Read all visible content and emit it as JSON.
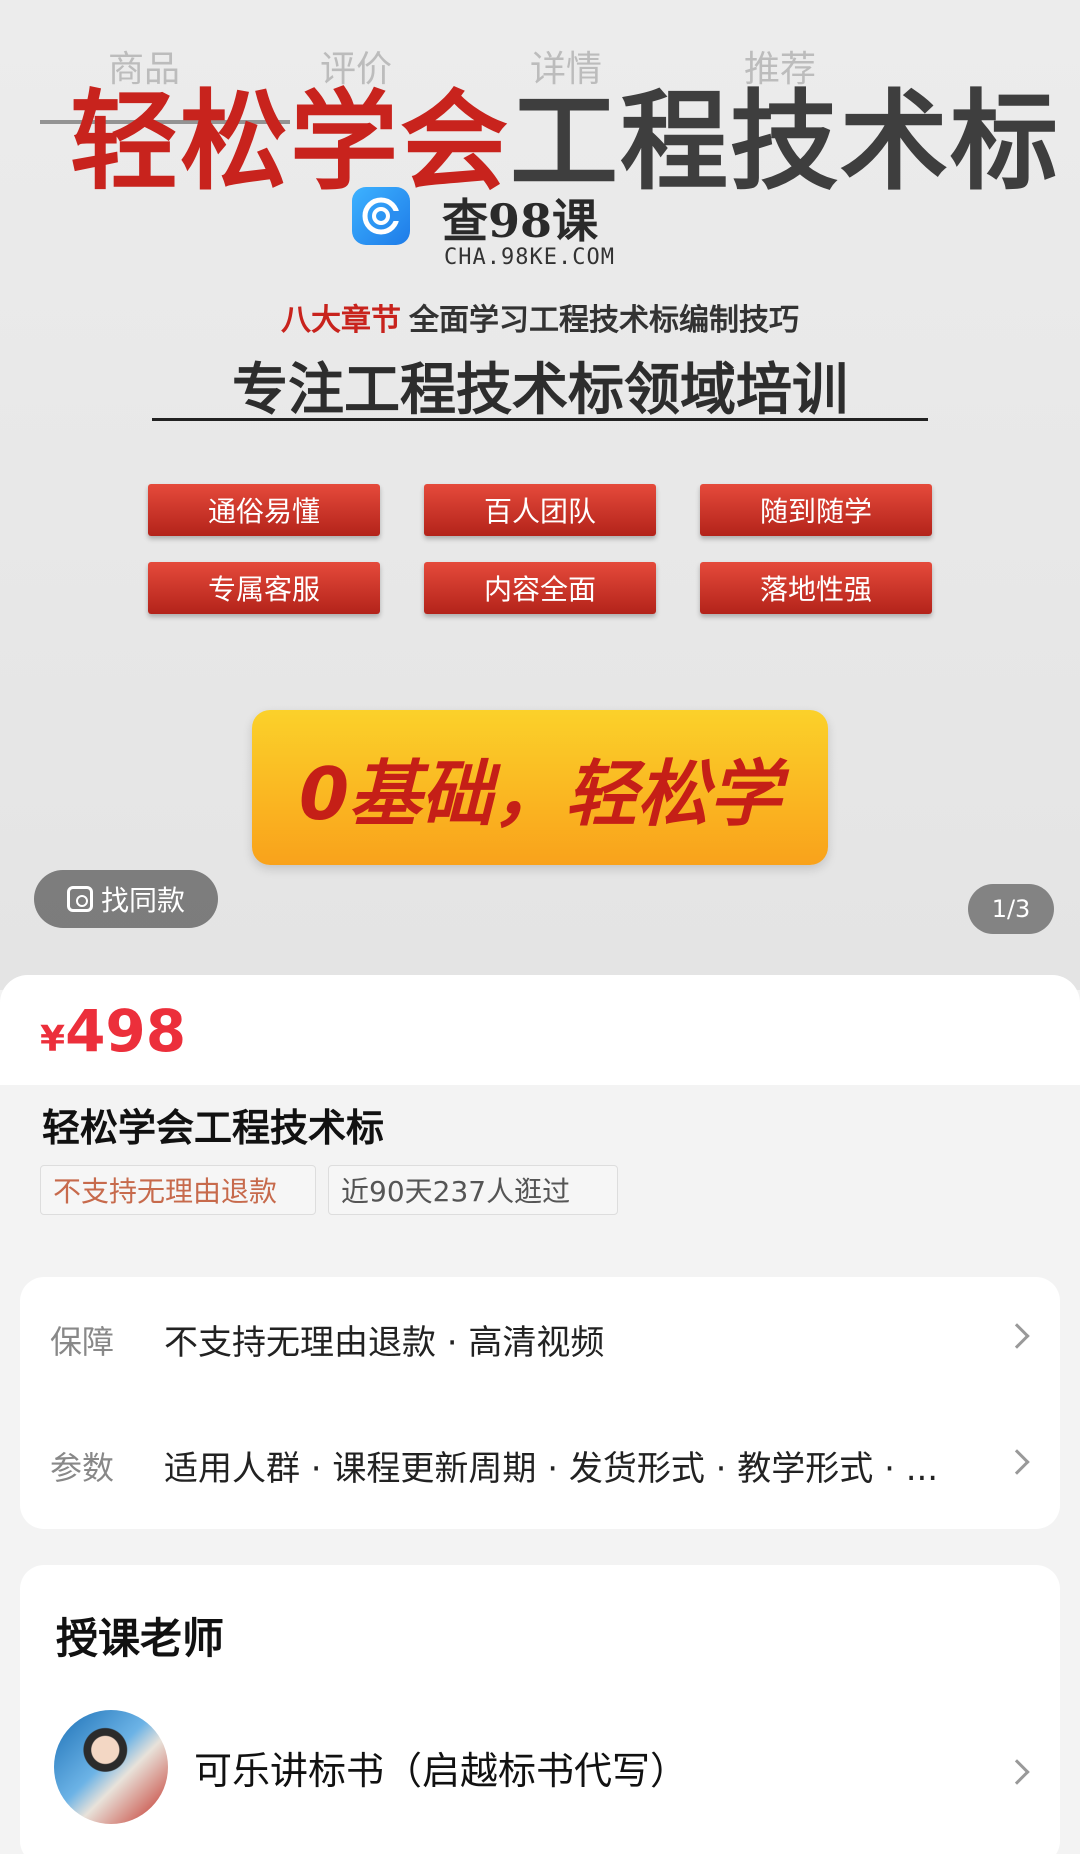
{
  "hero": {
    "tabs": [
      "商品",
      "评价",
      "详情",
      "推荐"
    ],
    "headline_red": "轻松学会",
    "headline_gray": "工程技术标",
    "watermark_name": "查98课",
    "watermark_url": "CHA.98KE.COM",
    "sub1_red": "八大章节",
    "sub1_text": "全面学习工程技术标编制技巧",
    "sub2": "专注工程技术标领域培训",
    "features": [
      "通俗易懂",
      "百人团队",
      "随到随学",
      "专属客服",
      "内容全面",
      "落地性强"
    ],
    "cta": "0基础，轻松学",
    "find_same": "找同款",
    "pager": "1/3"
  },
  "product": {
    "currency": "¥",
    "price": "498",
    "title": "轻松学会工程技术标",
    "tags": [
      "不支持无理由退款",
      "近90天237人逛过"
    ]
  },
  "guarantee": {
    "rows": [
      {
        "label": "保障",
        "value": "不支持无理由退款 · 高清视频"
      },
      {
        "label": "参数",
        "value": "适用人群 · 课程更新周期 · 发货形式 · 教学形式 · ..."
      }
    ]
  },
  "teacher": {
    "heading": "授课老师",
    "name": "可乐讲标书（启越标书代写）"
  },
  "colors": {
    "price": "#ec2f3b",
    "brand_red": "#c8231d",
    "cta": "#f9b51f"
  }
}
